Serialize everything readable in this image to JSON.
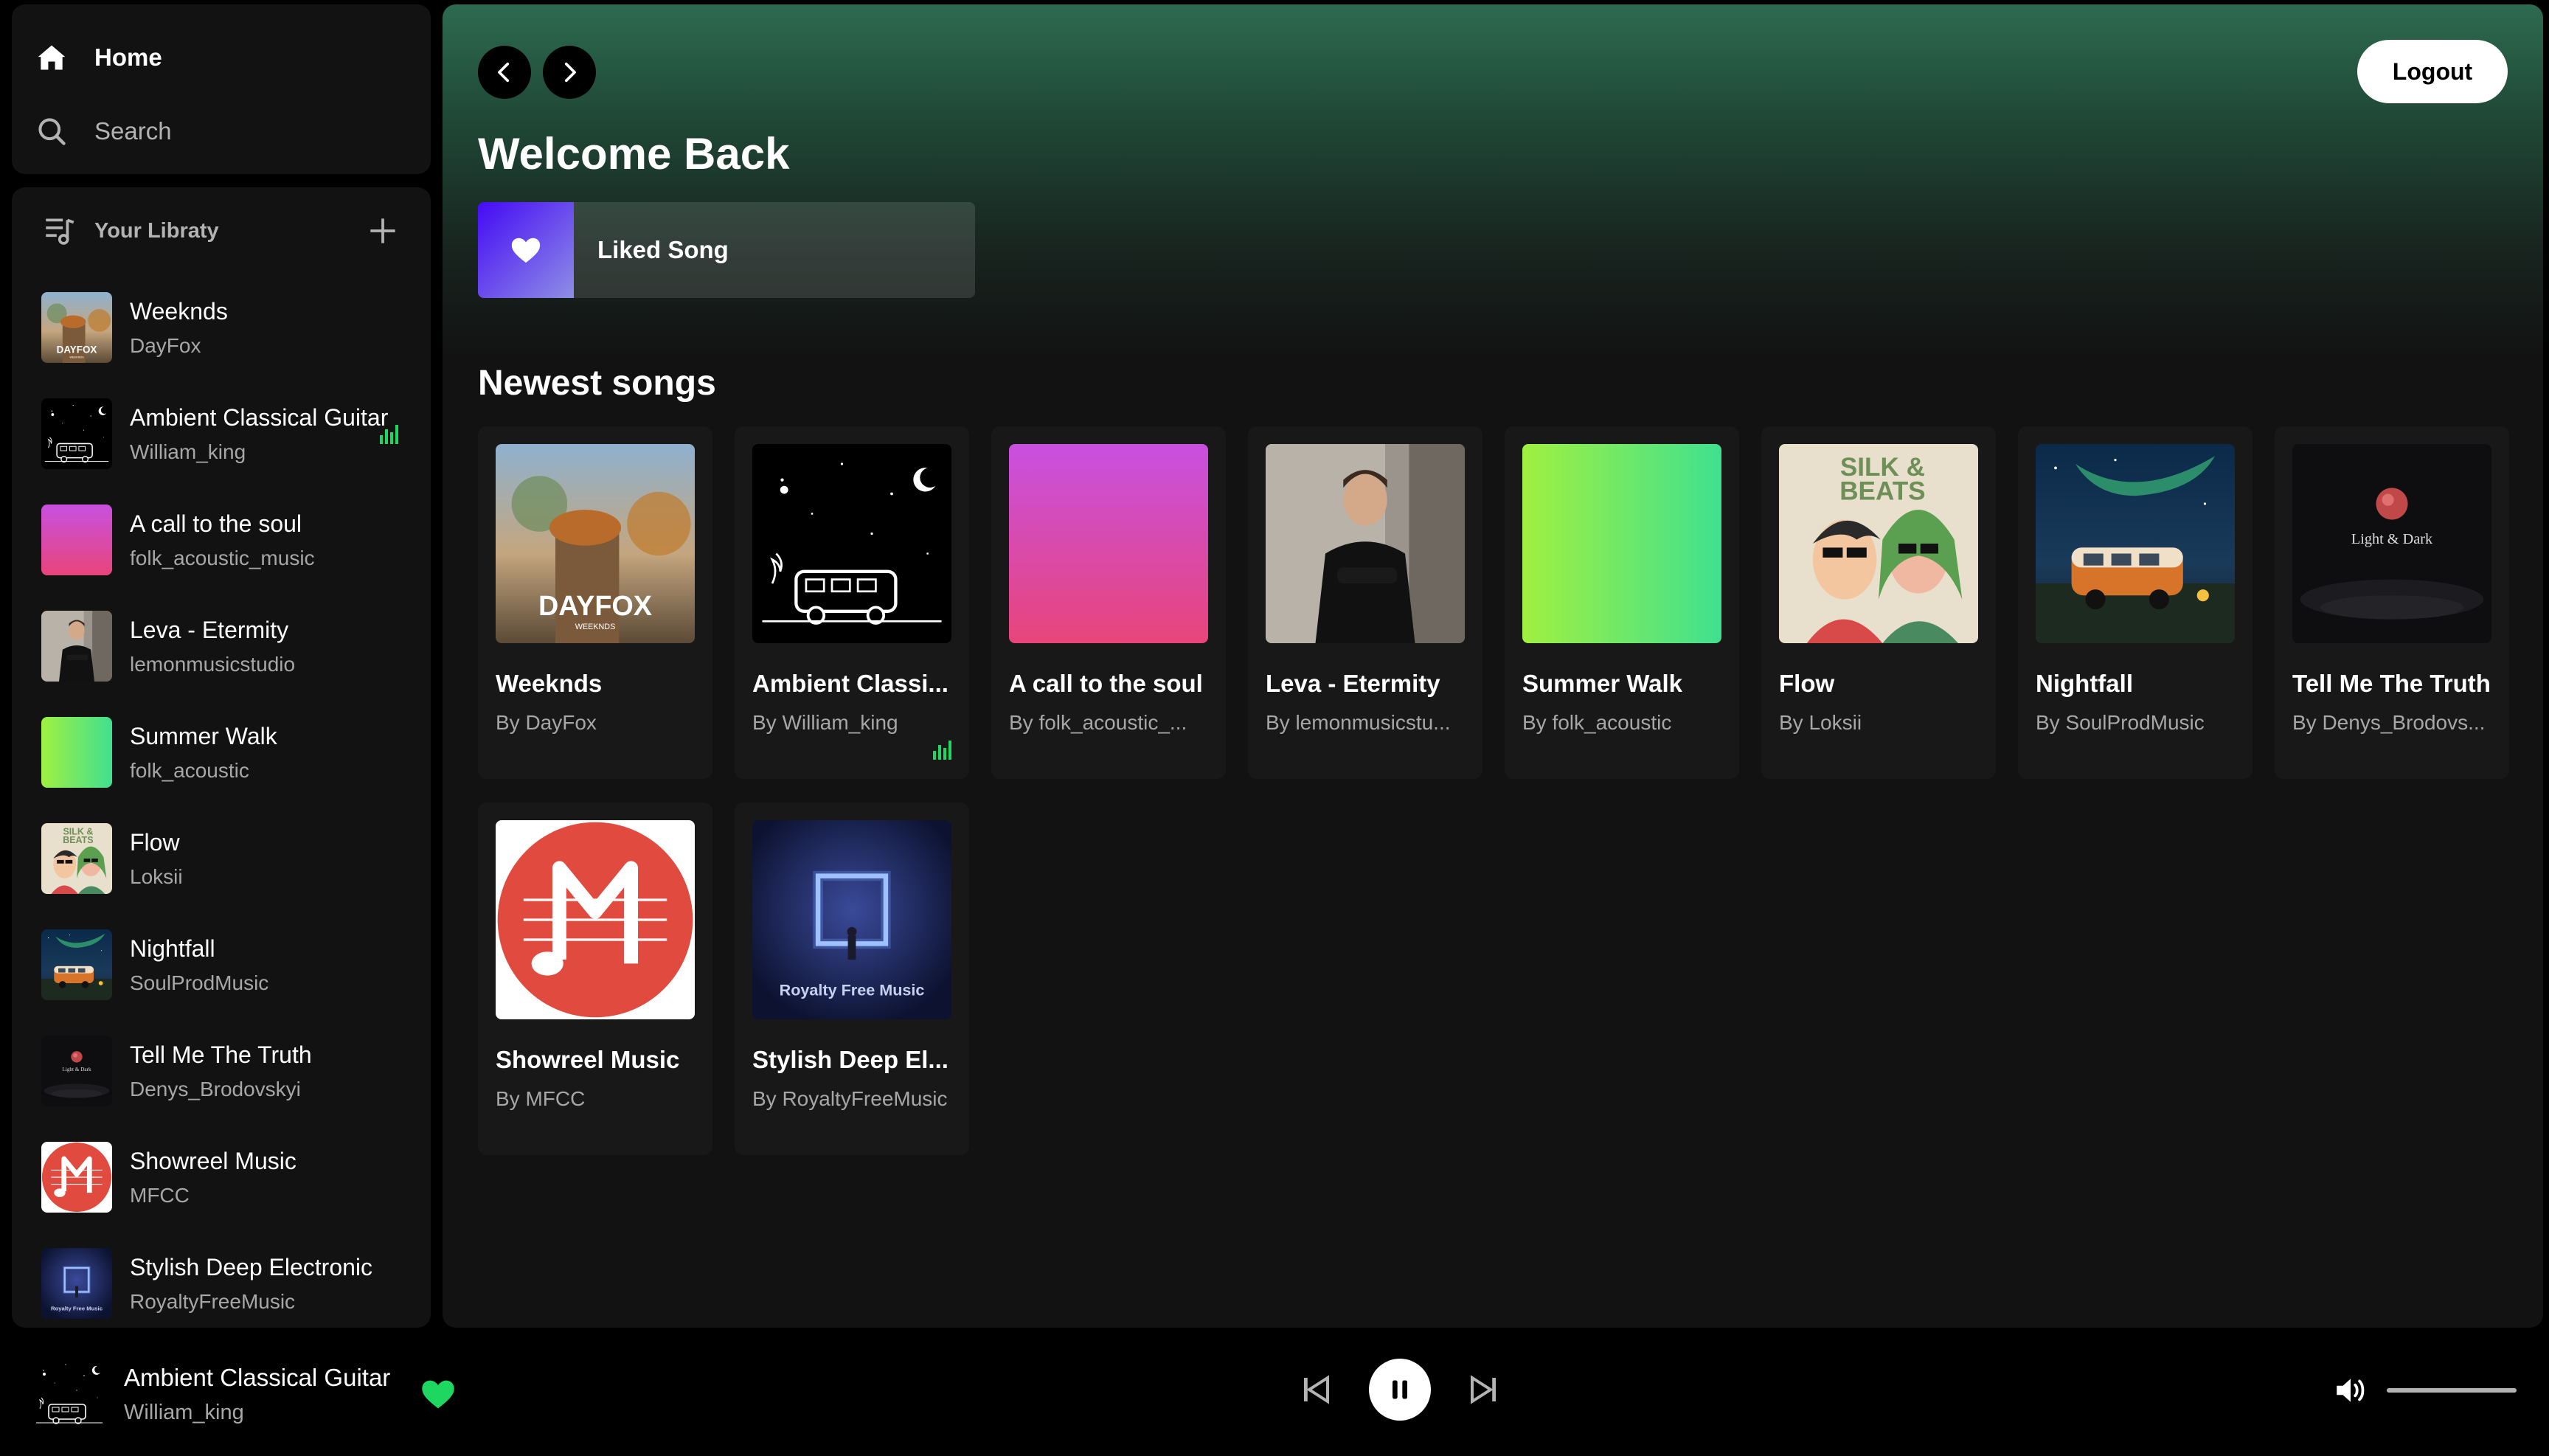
{
  "nav": {
    "home": "Home",
    "search": "Search"
  },
  "library": {
    "title": "Your Libraty",
    "items": [
      {
        "title": "Weeknds",
        "artist": "DayFox",
        "art": "dayfox"
      },
      {
        "title": "Ambient Classical Guitar",
        "artist": "William_king",
        "art": "ambient",
        "playing": true
      },
      {
        "title": "A call to the soul",
        "artist": "folk_acoustic_music",
        "art": "pink"
      },
      {
        "title": "Leva - Etermity",
        "artist": "lemonmusicstudio",
        "art": "leva"
      },
      {
        "title": "Summer Walk",
        "artist": "folk_acoustic",
        "art": "green"
      },
      {
        "title": "Flow",
        "artist": "Loksii",
        "art": "flow"
      },
      {
        "title": "Nightfall",
        "artist": "SoulProdMusic",
        "art": "nightfall"
      },
      {
        "title": "Tell Me The Truth",
        "artist": "Denys_Brodovskyi",
        "art": "truth"
      },
      {
        "title": "Showreel Music",
        "artist": "MFCC",
        "art": "showreel"
      },
      {
        "title": "Stylish Deep Electronic",
        "artist": "RoyaltyFreeMusic",
        "art": "stylish"
      }
    ]
  },
  "header": {
    "logout": "Logout",
    "welcome": "Welcome Back",
    "liked": "Liked Song"
  },
  "section": {
    "newest": "Newest songs"
  },
  "cards": [
    {
      "title": "Weeknds",
      "by": "By DayFox",
      "art": "dayfox"
    },
    {
      "title": "Ambient Classi...",
      "by": "By William_king",
      "art": "ambient",
      "playing": true
    },
    {
      "title": "A call to the soul",
      "by": "By folk_acoustic_...",
      "art": "pink"
    },
    {
      "title": "Leva - Etermity",
      "by": "By lemonmusicstu...",
      "art": "leva"
    },
    {
      "title": "Summer Walk",
      "by": "By folk_acoustic",
      "art": "green"
    },
    {
      "title": "Flow",
      "by": "By Loksii",
      "art": "flow"
    },
    {
      "title": "Nightfall",
      "by": "By SoulProdMusic",
      "art": "nightfall"
    },
    {
      "title": "Tell Me The Truth",
      "by": "By Denys_Brodovs...",
      "art": "truth"
    },
    {
      "title": "Showreel Music",
      "by": "By MFCC",
      "art": "showreel"
    },
    {
      "title": "Stylish Deep El...",
      "by": "By RoyaltyFreeMusic",
      "art": "stylish"
    }
  ],
  "art_text": {
    "dayfox": "DAYFOX",
    "dayfox_sub": "WEEKNDS",
    "flow": "SILK &",
    "flow2": "BEATS",
    "truth": "Light & Dark",
    "stylish": "Royalty Free Music"
  },
  "player": {
    "title": "Ambient Classical Guitar",
    "artist": "William_king",
    "art": "ambient",
    "volume": 1.0
  },
  "colors": {
    "accent": "#1ed760",
    "header_green": "#2d6a4f"
  }
}
